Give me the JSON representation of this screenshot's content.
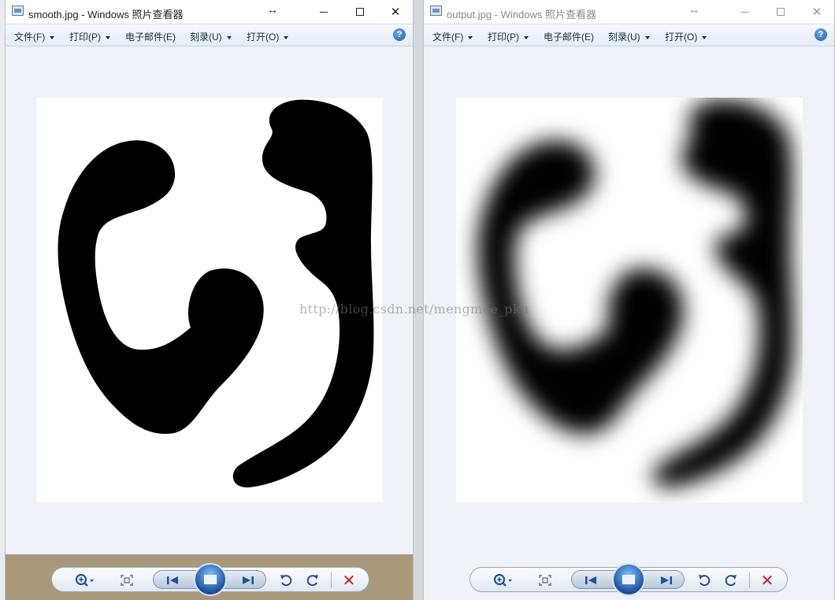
{
  "windows": {
    "left": {
      "title": "smooth.jpg - Windows 照片查看器",
      "active": true
    },
    "right": {
      "title": "output.jpg - Windows 照片查看器",
      "active": false
    }
  },
  "controls": {
    "resize_glyph": "↔",
    "close": "✕"
  },
  "menu": {
    "file": "文件(F)",
    "print": "打印(P)",
    "email": "电子邮件(E)",
    "burn": "刻录(U)",
    "open": "打开(O)",
    "help": "?"
  },
  "image": {
    "watermark": "http://blog.csdn.net/mengmee_pku",
    "left_style": "sharp binary",
    "right_style": "gaussian blurred"
  },
  "toolbar": {
    "zoom_icon": "zoom-icon",
    "fit_icon": "actual-size-icon",
    "prev_icon": "previous-icon",
    "slideshow_icon": "slideshow-icon",
    "next_icon": "next-icon",
    "rotate_ccw_icon": "rotate-counterclockwise-icon",
    "rotate_cw_icon": "rotate-clockwise-icon",
    "delete_icon": "delete-icon"
  },
  "colors": {
    "menubar": "#e4ecf6",
    "workspace": "#eef2f8",
    "left_bottom_bar": "#a9987a",
    "accent": "#2a5aa0",
    "delete": "#c8202a"
  }
}
